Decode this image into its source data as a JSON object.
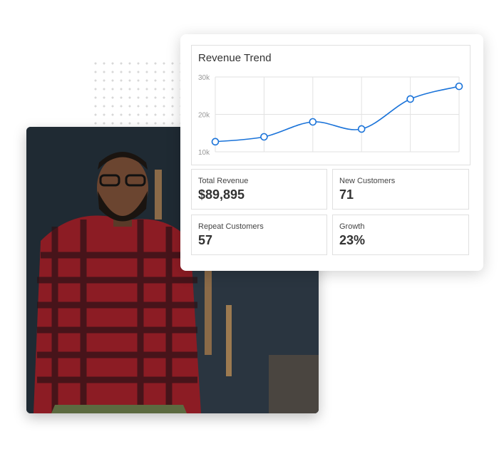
{
  "chart_data": {
    "type": "line",
    "title": "Revenue Trend",
    "x": [
      1,
      2,
      3,
      4,
      5,
      6
    ],
    "values": [
      12700,
      14000,
      18000,
      16100,
      24100,
      27500
    ],
    "ylim": [
      10000,
      30000
    ],
    "yticks": [
      "10k",
      "20k",
      "30k"
    ],
    "grid": true,
    "line_color": "#1a73d9"
  },
  "stats": [
    {
      "label": "Total Revenue",
      "value": "$89,895"
    },
    {
      "label": "New Customers",
      "value": "71"
    },
    {
      "label": "Repeat Customers",
      "value": "57"
    },
    {
      "label": "Growth",
      "value": "23%"
    }
  ]
}
